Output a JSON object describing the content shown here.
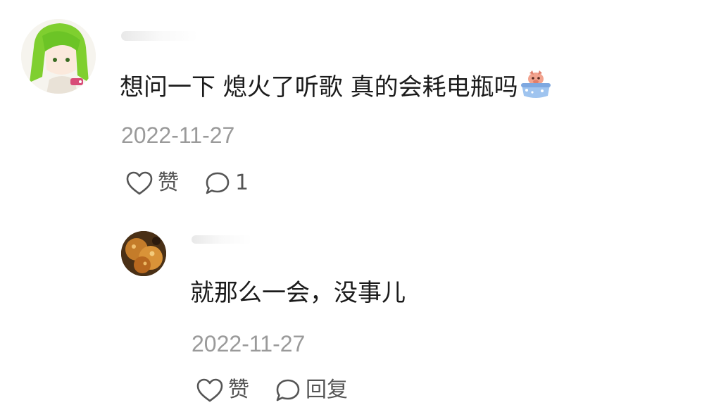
{
  "comments": [
    {
      "text": "想问一下 熄火了听歌 真的会耗电瓶吗",
      "emoji_icon": "pig-in-bathtub-emoji",
      "date": "2022-11-27",
      "like_label": "赞",
      "reply_count": "1"
    },
    {
      "text": "就那么一会，没事儿",
      "date": "2022-11-27",
      "like_label": "赞",
      "reply_label": "回复"
    }
  ],
  "colors": {
    "text": "#1b1b1b",
    "date": "#9a9a9a",
    "action": "#555555",
    "background": "#ffffff"
  }
}
